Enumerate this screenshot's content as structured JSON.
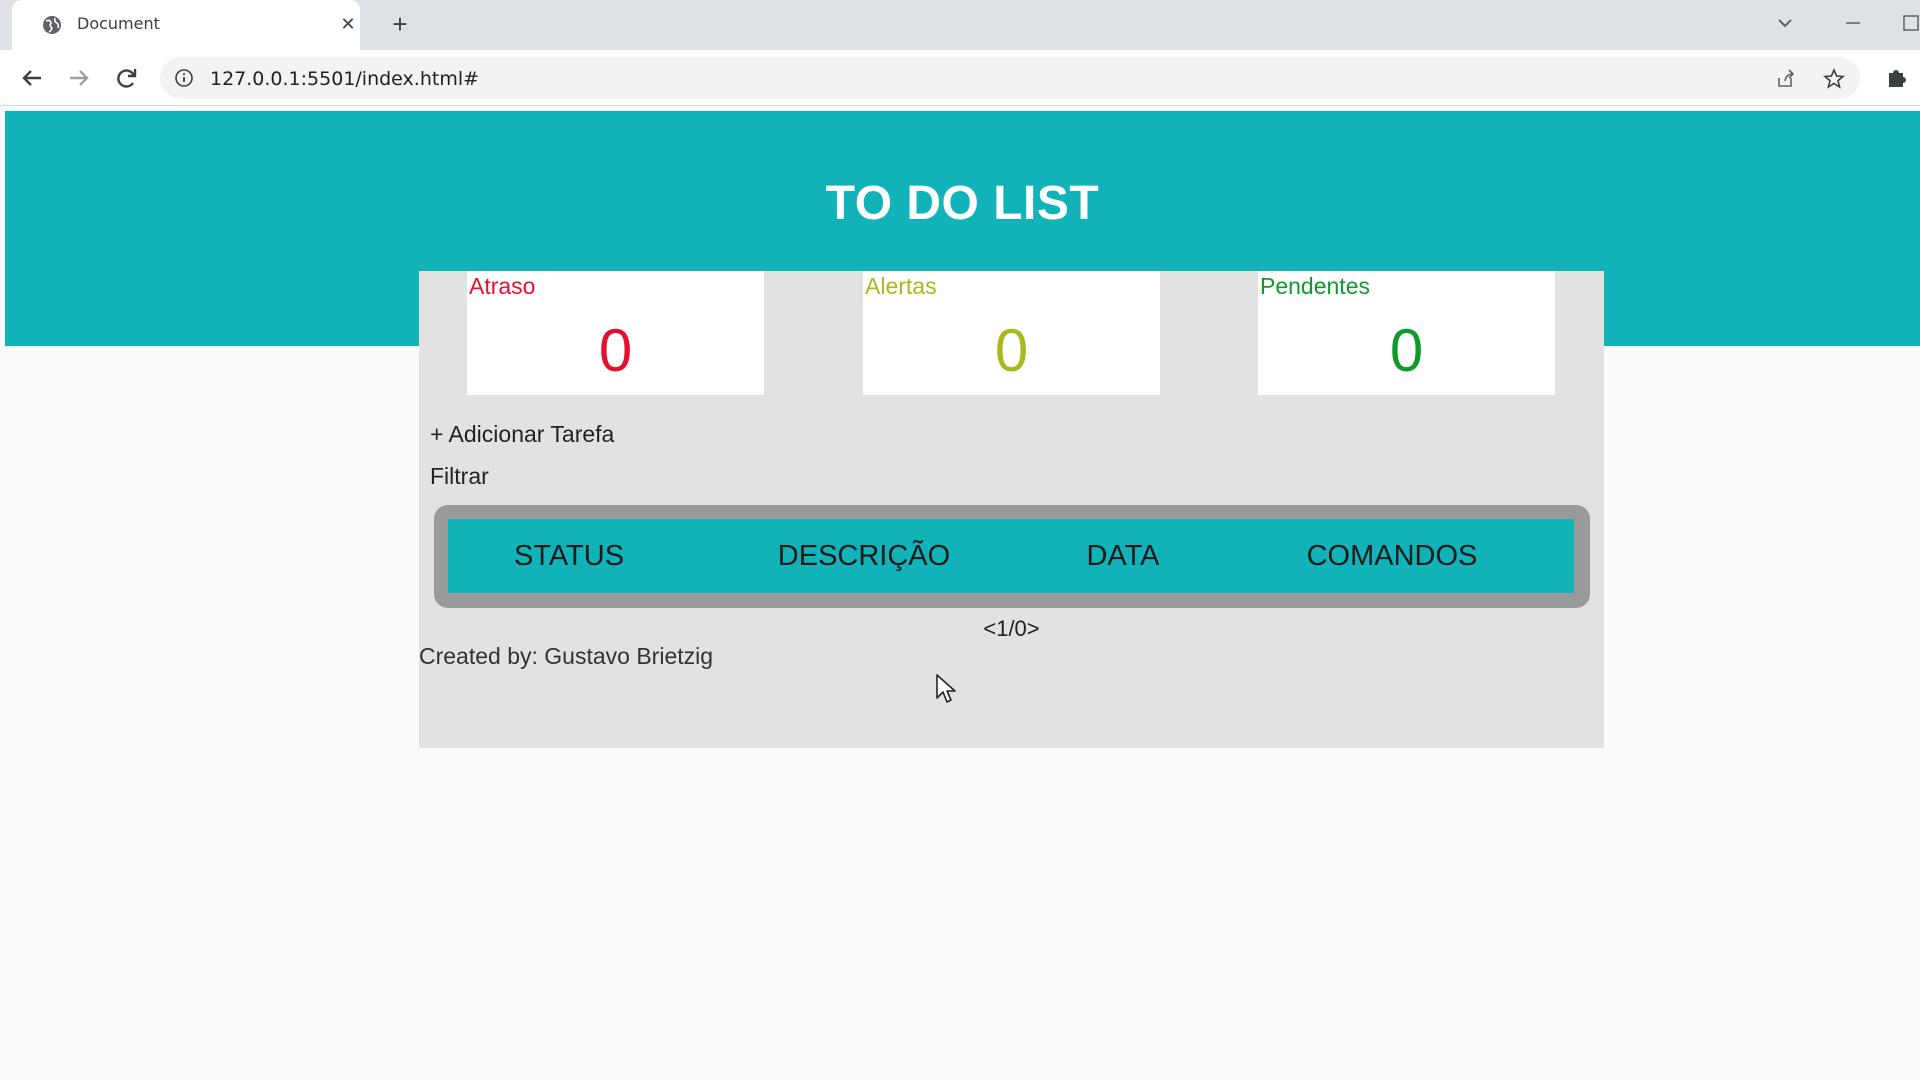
{
  "browser": {
    "tab_title": "Document",
    "tab_close": "✕",
    "new_tab": "+",
    "url": "127.0.0.1:5501/index.html#"
  },
  "page": {
    "title": "TO DO LIST",
    "counters": [
      {
        "label": "Atraso",
        "count": "0",
        "color": "#e5102f"
      },
      {
        "label": "Alertas",
        "count": "0",
        "color": "#a9b81b"
      },
      {
        "label": "Pendentes",
        "count": "0",
        "color": "#109a2a"
      }
    ],
    "add_task": "+ Adicionar Tarefa",
    "filter": "Filtrar",
    "table": {
      "headers": [
        "STATUS",
        "DESCRIÇÃO",
        "DATA",
        "COMANDOS"
      ]
    },
    "pager": "<1/0>",
    "footer": "Created by: Gustavo Brietzig"
  },
  "colors": {
    "accent": "#12b2b9",
    "panel": "#e2e2e2"
  }
}
